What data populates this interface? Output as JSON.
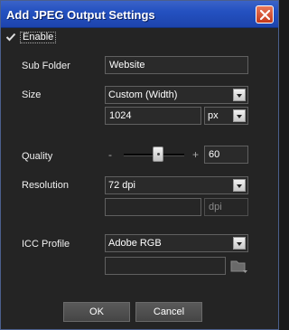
{
  "dialog": {
    "title": "Add JPEG Output Settings",
    "close_icon": "close-icon"
  },
  "enable": {
    "label": "Enable",
    "checked": true
  },
  "sub_folder": {
    "label": "Sub Folder",
    "value": "Website"
  },
  "size": {
    "label": "Size",
    "mode": "Custom (Width)",
    "value": "1024",
    "unit": "px"
  },
  "quality": {
    "label": "Quality",
    "minus": "-",
    "plus": "+",
    "value": "60",
    "level": 60
  },
  "resolution": {
    "label": "Resolution",
    "preset": "72 dpi",
    "value": "",
    "unit": "dpi"
  },
  "icc_profile": {
    "label": "ICC Profile",
    "value": "Adobe RGB",
    "custom_path": "",
    "browse_icon": "folder-icon"
  },
  "buttons": {
    "ok": "OK",
    "cancel": "Cancel"
  }
}
